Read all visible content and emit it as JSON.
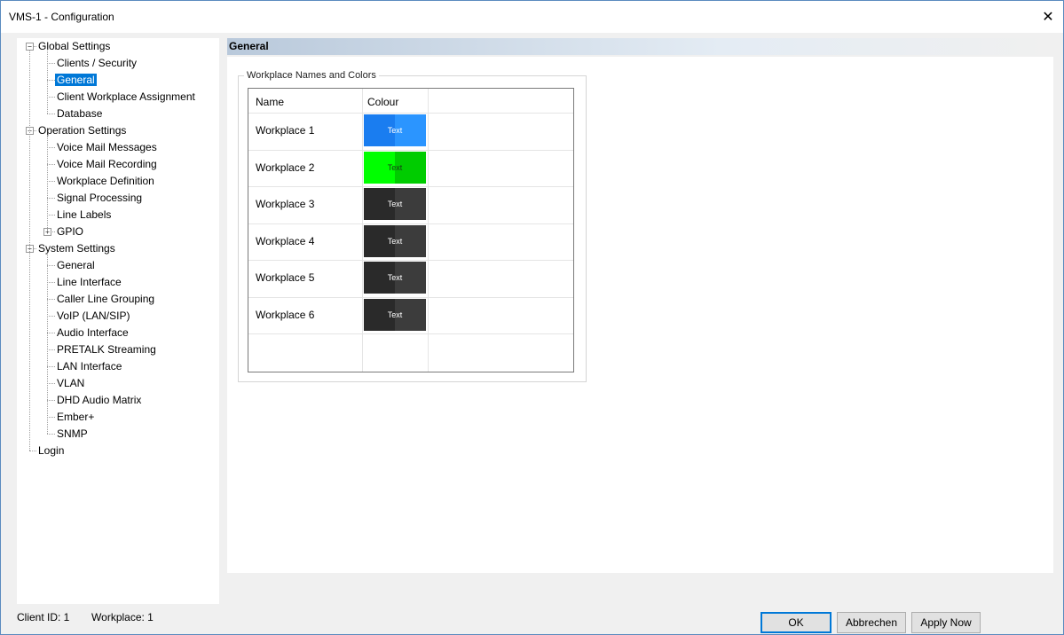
{
  "window": {
    "title": "VMS-1 - Configuration",
    "close_label": "✕"
  },
  "tree": {
    "items": [
      {
        "label": "Global Settings",
        "level": 0,
        "expander": "−"
      },
      {
        "label": "Clients / Security",
        "level": 1
      },
      {
        "label": "General",
        "level": 1,
        "selected": true
      },
      {
        "label": "Client Workplace Assignment",
        "level": 1
      },
      {
        "label": "Database",
        "level": 1
      },
      {
        "label": "Operation Settings",
        "level": 0,
        "expander": "−"
      },
      {
        "label": "Voice Mail Messages",
        "level": 1
      },
      {
        "label": "Voice Mail Recording",
        "level": 1
      },
      {
        "label": "Workplace Definition",
        "level": 1
      },
      {
        "label": "Signal Processing",
        "level": 1
      },
      {
        "label": "Line Labels",
        "level": 1
      },
      {
        "label": "GPIO",
        "level": 1,
        "expander": "+"
      },
      {
        "label": "System Settings",
        "level": 0,
        "expander": "−"
      },
      {
        "label": "General",
        "level": 1
      },
      {
        "label": "Line Interface",
        "level": 1
      },
      {
        "label": "Caller Line Grouping",
        "level": 1
      },
      {
        "label": "VoIP (LAN/SIP)",
        "level": 1
      },
      {
        "label": "Audio Interface",
        "level": 1
      },
      {
        "label": "PRETALK Streaming",
        "level": 1
      },
      {
        "label": "LAN Interface",
        "level": 1
      },
      {
        "label": "VLAN",
        "level": 1
      },
      {
        "label": "DHD Audio Matrix",
        "level": 1
      },
      {
        "label": "Ember+",
        "level": 1
      },
      {
        "label": "SNMP",
        "level": 1
      },
      {
        "label": "Login",
        "level": 0
      }
    ]
  },
  "content": {
    "header": "General",
    "group_title": "Workplace Names and Colors",
    "columns": {
      "name": "Name",
      "colour": "Colour"
    },
    "rows": [
      {
        "name": "Workplace 1",
        "swatch_text": "Text",
        "color_left": "#1a7df0",
        "color_right": "#2b95ff",
        "text_color": "#ffffff"
      },
      {
        "name": "Workplace 2",
        "swatch_text": "Text",
        "color_left": "#00ff00",
        "color_right": "#00cc00",
        "text_color": "#1a3a1a"
      },
      {
        "name": "Workplace 3",
        "swatch_text": "Text",
        "color_left": "#2a2a2a",
        "color_right": "#3c3c3c",
        "text_color": "#ffffff"
      },
      {
        "name": "Workplace 4",
        "swatch_text": "Text",
        "color_left": "#2a2a2a",
        "color_right": "#3c3c3c",
        "text_color": "#ffffff"
      },
      {
        "name": "Workplace 5",
        "swatch_text": "Text",
        "color_left": "#2a2a2a",
        "color_right": "#3c3c3c",
        "text_color": "#ffffff"
      },
      {
        "name": "Workplace 6",
        "swatch_text": "Text",
        "color_left": "#2a2a2a",
        "color_right": "#3c3c3c",
        "text_color": "#ffffff"
      }
    ]
  },
  "status": {
    "client_id": "Client ID: 1",
    "workplace": "Workplace: 1"
  },
  "buttons": {
    "ok": "OK",
    "cancel": "Abbrechen",
    "apply": "Apply Now"
  }
}
